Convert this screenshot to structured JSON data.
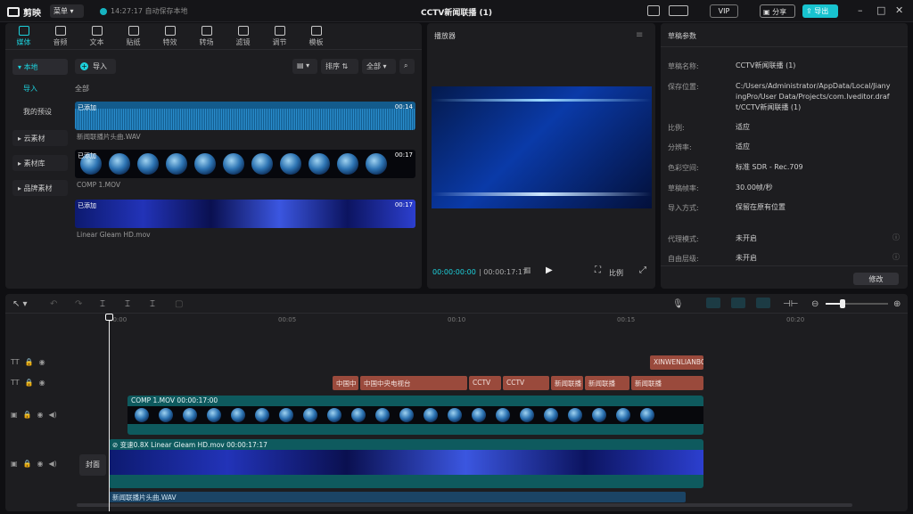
{
  "app": {
    "logo_text": "剪映",
    "menu_label": "菜单",
    "save_status": "14:27:17 自动保存本地",
    "project_title": "CCTV新闻联播 (1)",
    "vip_label": "VIP",
    "share_label": "分享",
    "export_label": "导出"
  },
  "media": {
    "tabs": [
      {
        "label": "媒体",
        "icon": "media-icon"
      },
      {
        "label": "音频",
        "icon": "audio-icon"
      },
      {
        "label": "文本",
        "icon": "text-icon"
      },
      {
        "label": "贴纸",
        "icon": "sticker-icon"
      },
      {
        "label": "特效",
        "icon": "effects-icon"
      },
      {
        "label": "转场",
        "icon": "transition-icon"
      },
      {
        "label": "滤镜",
        "icon": "filter-icon"
      },
      {
        "label": "调节",
        "icon": "adjust-icon"
      },
      {
        "label": "模板",
        "icon": "template-icon"
      }
    ],
    "sidebar": {
      "local": "本地",
      "import": "导入",
      "presets": "我的预设",
      "cloud": "云素材",
      "library": "素材库",
      "brand": "品牌素材"
    },
    "import_label": "导入",
    "sort_label": "排序",
    "filter_label": "全部",
    "section_label": "全部",
    "clips": [
      {
        "title": "已添加",
        "duration": "00:14",
        "name": "新闻联播片头曲.WAV"
      },
      {
        "title": "已添加",
        "duration": "00:17",
        "name": "COMP 1.MOV"
      },
      {
        "title": "已添加",
        "duration": "00:17",
        "name": "Linear Gleam HD.mov"
      }
    ]
  },
  "player": {
    "title": "播放器",
    "current_time": "00:00:00:00",
    "total_time": "00:00:17:17",
    "ratio_label": "比例"
  },
  "props": {
    "header": "草稿参数",
    "rows": [
      {
        "label": "草稿名称:",
        "value": "CCTV新闻联播 (1)"
      },
      {
        "label": "保存位置:",
        "value": "C:/Users/Administrator/AppData/Local/JianyingPro/User Data/Projects/com.lveditor.draft/CCTV新闻联播 (1)"
      },
      {
        "label": "比例:",
        "value": "适应"
      },
      {
        "label": "分辨率:",
        "value": "适应"
      },
      {
        "label": "色彩空间:",
        "value": "标准 SDR - Rec.709"
      },
      {
        "label": "草稿帧率:",
        "value": "30.00帧/秒"
      },
      {
        "label": "导入方式:",
        "value": "保留在原有位置"
      },
      {
        "label": "代理模式:",
        "value": "未开启"
      },
      {
        "label": "自由层级:",
        "value": "未开启"
      }
    ],
    "edit_label": "修改"
  },
  "timeline": {
    "ruler": [
      "00:00",
      "00:05",
      "00:10",
      "00:15",
      "00:20"
    ],
    "text_track_1": [
      {
        "label": "XINWENLIANBO"
      }
    ],
    "text_track_2": [
      {
        "label": "中国中"
      },
      {
        "label": "中国中央电视台"
      },
      {
        "label": "CCTV"
      },
      {
        "label": "CCTV"
      },
      {
        "label": "新闻联播"
      },
      {
        "label": "新闻联播"
      },
      {
        "label": "新闻联播"
      }
    ],
    "video_track_1": {
      "label": "COMP 1.MOV  00:00:17:00"
    },
    "main_track": {
      "label": "变速0.8X  Linear Gleam HD.mov  00:00:17:17"
    },
    "cover_label": "封面",
    "audio_track": {
      "label": "新闻联播片头曲.WAV"
    }
  }
}
